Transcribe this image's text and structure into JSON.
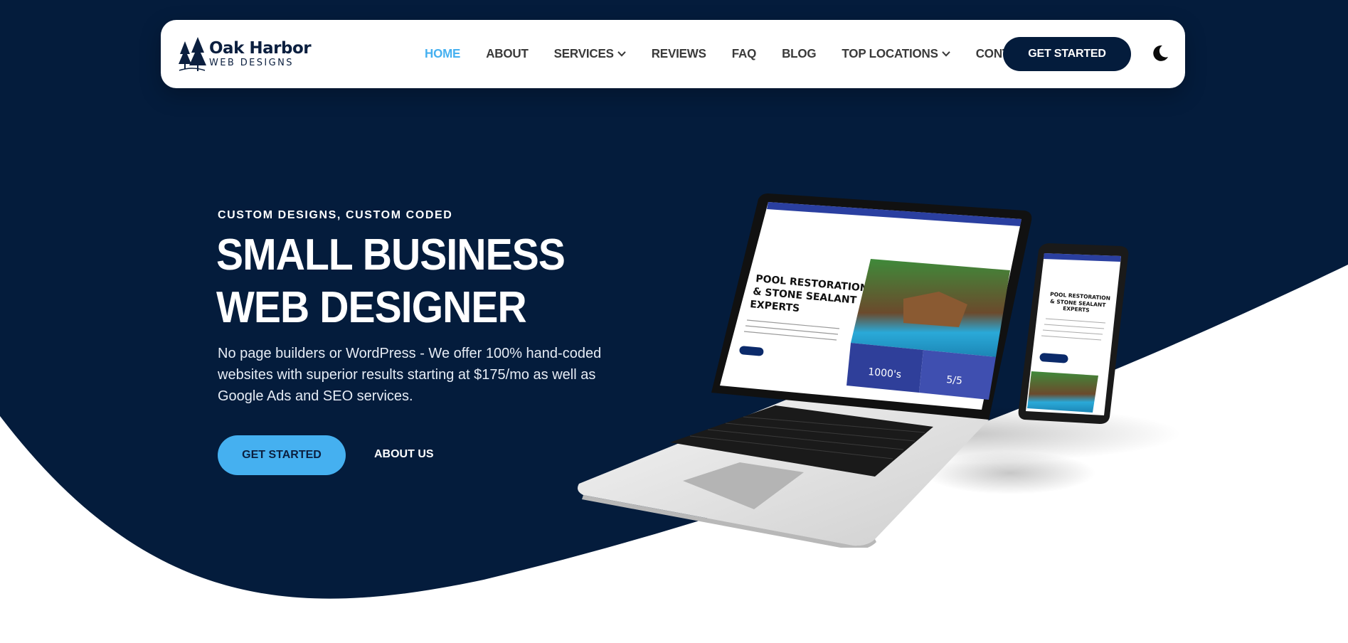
{
  "brand": {
    "name": "Oak Harbor",
    "sub": "WEB DESIGNS"
  },
  "nav": {
    "items": [
      {
        "label": "HOME",
        "active": true
      },
      {
        "label": "ABOUT"
      },
      {
        "label": "SERVICES",
        "dropdown": true
      },
      {
        "label": "REVIEWS"
      },
      {
        "label": "FAQ"
      },
      {
        "label": "BLOG"
      },
      {
        "label": "TOP LOCATIONS",
        "dropdown": true
      },
      {
        "label": "CONTACT"
      }
    ],
    "cta_label": "GET STARTED",
    "theme_icon": "moon-icon"
  },
  "hero": {
    "eyebrow": "CUSTOM DESIGNS, CUSTOM CODED",
    "headline_line1": "SMALL BUSINESS",
    "headline_line2": "WEB DESIGNER",
    "description": "No page builders or WordPress - We offer 100% hand-coded websites with superior results starting at $175/mo as well as Google Ads and SEO services.",
    "cta_label": "GET STARTED",
    "secondary_label": "ABOUT US"
  },
  "mockup": {
    "laptop_title_1": "POOL RESTORATION",
    "laptop_title_2": "& STONE SEALANT",
    "laptop_title_3": "EXPERTS",
    "stat1_value": "1000's",
    "stat2_value": "5/5",
    "phone_title_1": "POOL RESTORATION",
    "phone_title_2": "& STONE SEALANT",
    "phone_title_3": "EXPERTS"
  },
  "colors": {
    "navy": "#041c3c",
    "accent": "#45b0f0",
    "white": "#ffffff"
  }
}
